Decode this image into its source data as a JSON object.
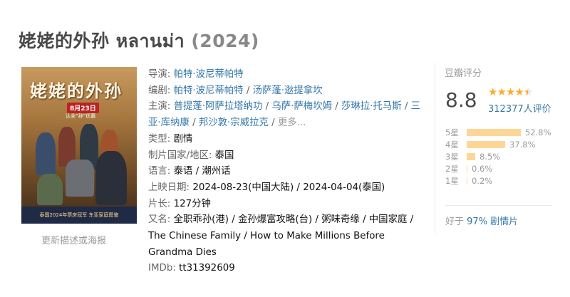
{
  "title": {
    "name": "姥姥的外孙 หลานม่า",
    "year": "(2024)"
  },
  "poster": {
    "title_text": "姥姥的外孙",
    "date": "8月23日",
    "tagline": "认全“孙”优惠",
    "banner": "泰国2024年票房冠军 东亚家庭图鉴",
    "update_link": "更新描述或海报"
  },
  "info": {
    "director_label": "导演:",
    "director": "帕特·波尼蒂帕特",
    "writer_label": "编剧:",
    "writers": [
      "帕特·波尼蒂帕特",
      "汤萨蓬·逖提拿坎"
    ],
    "cast_label": "主演:",
    "cast": [
      "普提蓬·阿萨拉塔纳功",
      "乌萨·萨梅坎姆",
      "莎琳拉·托马斯",
      "三亚·库纳康",
      "邦沙敦·宗威拉克"
    ],
    "cast_more": "更多...",
    "genre_label": "类型:",
    "genre": "剧情",
    "country_label": "制片国家/地区:",
    "country": "泰国",
    "language_label": "语言:",
    "language": "泰语 / 潮州话",
    "release_label": "上映日期:",
    "release": "2024-08-23(中国大陆) / 2024-04-04(泰国)",
    "runtime_label": "片长:",
    "runtime": "127分钟",
    "aka_label": "又名:",
    "aka": "全职乖孙(港) / 金孙爆富攻略(台) / 粥味奇缘 / 中国家庭 / The Chinese Family / How to Make Millions Before Grandma Dies",
    "imdb_label": "IMDb:",
    "imdb": "tt31392609"
  },
  "rating": {
    "panel_title": "豆瓣评分",
    "score": "8.8",
    "stars_filled": 4.5,
    "votes": "312377人评价",
    "distribution": [
      {
        "label": "5星",
        "percent": 52.8,
        "text": "52.8%"
      },
      {
        "label": "4星",
        "percent": 37.8,
        "text": "37.8%"
      },
      {
        "label": "3星",
        "percent": 8.5,
        "text": "8.5%"
      },
      {
        "label": "2星",
        "percent": 0.6,
        "text": "0.6%"
      },
      {
        "label": "1星",
        "percent": 0.2,
        "text": "0.2%"
      }
    ],
    "better_than_prefix": "好于",
    "better_than": "97% 剧情片",
    "colors": {
      "bar": "#ffd596",
      "star": "#ffac2d",
      "link": "#3377aa"
    }
  }
}
